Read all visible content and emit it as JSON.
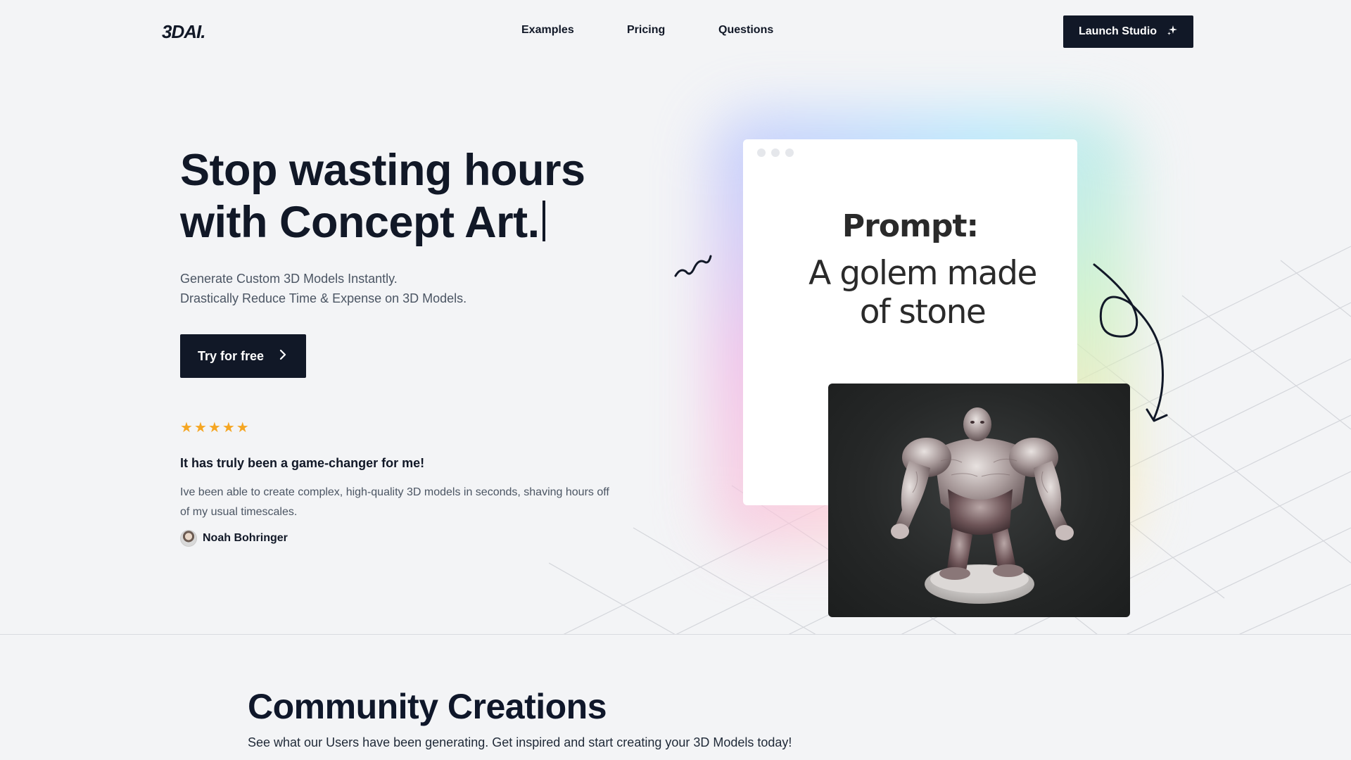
{
  "nav": {
    "logo": "3DAI.",
    "links": [
      "Examples",
      "Pricing",
      "Questions"
    ],
    "cta_label": "Launch Studio",
    "cta_icon": "sparkle-icon"
  },
  "hero": {
    "title_line1": "Stop wasting hours",
    "title_line2": "with Concept Art.",
    "subtitle_line1": "Generate Custom 3D Models Instantly.",
    "subtitle_line2": "Drastically Reduce Time & Expense on 3D Models.",
    "cta_label": "Try for free",
    "cta_icon": "chevron-right-icon"
  },
  "testimonial": {
    "rating": 5,
    "title": "It has truly been a game-changer for me!",
    "text": "Ive been able to create complex, high-quality 3D models in seconds, shaving hours off of my usual timescales.",
    "author": "Noah Bohringer"
  },
  "demo": {
    "prompt_label": "Prompt:",
    "prompt_text": "A golem made of stone",
    "model_image": "stone golem 3D model"
  },
  "community": {
    "title": "Community Creations",
    "subtitle": "See what our Users have been generating. Get inspired and start creating your 3D Models today!"
  },
  "colors": {
    "background": "#f3f4f6",
    "primary": "#111827",
    "star": "#f5a623",
    "muted_text": "#4b5563"
  }
}
